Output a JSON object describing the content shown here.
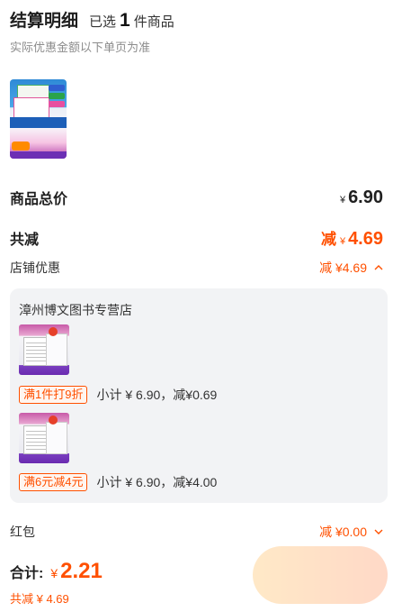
{
  "header": {
    "title": "结算明细",
    "selected_prefix": "已选",
    "selected_count": "1",
    "selected_suffix": "件商品",
    "subtitle": "实际优惠金额以下单页为准"
  },
  "summary": {
    "goods_total_label": "商品总价",
    "currency": "¥",
    "goods_total": "6.90",
    "discount_total_label": "共减",
    "discount_prefix": "减",
    "discount_total": "4.69",
    "shop_discount_label": "店铺优惠",
    "shop_discount_value": "减 ¥4.69",
    "red_packet_label": "红包",
    "red_packet_value": "减 ¥0.00"
  },
  "store": {
    "name": "漳州博文图书专营店",
    "promos": [
      {
        "badge": "满1件打9折",
        "text": "小计 ¥ 6.90，减¥0.69"
      },
      {
        "badge": "满6元减4元",
        "text": "小计 ¥ 6.90，减¥4.00"
      }
    ]
  },
  "footer": {
    "total_label": "合计:",
    "total_currency": "¥",
    "total_value": "2.21",
    "saved_text": "共减 ¥ 4.69"
  },
  "colors": {
    "accent": "#ff5000",
    "panel": "#f2f3f5"
  }
}
